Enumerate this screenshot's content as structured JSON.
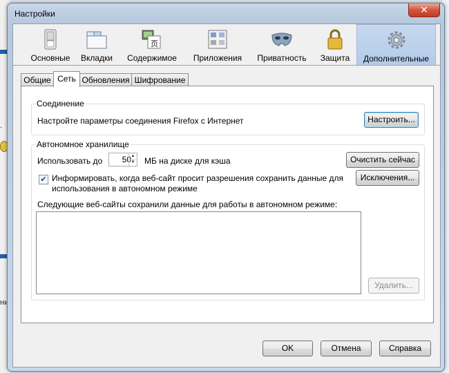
{
  "window": {
    "title": "Настройки",
    "close_glyph": "✕"
  },
  "background_text": {
    "left_1": ".",
    "left_2": "ни"
  },
  "panes": [
    {
      "label": "Основные",
      "icon": "switch-icon"
    },
    {
      "label": "Вкладки",
      "icon": "tabs-icon"
    },
    {
      "label": "Содержимое",
      "icon": "content-icon"
    },
    {
      "label": "Приложения",
      "icon": "applications-icon"
    },
    {
      "label": "Приватность",
      "icon": "mask-icon"
    },
    {
      "label": "Защита",
      "icon": "lock-icon"
    },
    {
      "label": "Дополнительные",
      "icon": "gear-icon"
    }
  ],
  "active_pane": "Дополнительные",
  "tabs": [
    "Общие",
    "Сеть",
    "Обновления",
    "Шифрование"
  ],
  "selected_tab": "Сеть",
  "connection": {
    "title": "Соединение",
    "description": "Настройте параметры соединения Firefox с Интернет",
    "configure_button": "Настроить..."
  },
  "offline": {
    "title": "Автономное хранилище",
    "use_up_to_label": "Использовать до",
    "cache_value": "50",
    "cache_unit_label": "МБ на диске для кэша",
    "clear_now_button": "Очистить сейчас",
    "notify_checked": true,
    "notify_line1": "Информировать, когда веб-сайт просит разрешения сохранить данные для",
    "notify_line2": "использования в автономном режиме",
    "exceptions_button": "Исключения...",
    "sites_label": "Следующие веб-сайты сохранили данные для работы в автономном режиме:",
    "sites": [],
    "remove_button": "Удалить..."
  },
  "footer": {
    "ok": "OK",
    "cancel": "Отмена",
    "help": "Справка"
  }
}
